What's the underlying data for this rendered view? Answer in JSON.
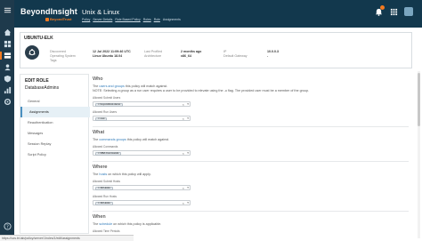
{
  "app": {
    "brand": "BeyondInsight",
    "brand_sub": "BeyondTrust",
    "page_heading": "Unix & Linux"
  },
  "breadcrumb": [
    "Policy",
    "Server Details",
    "Role Based Policy",
    "Roles",
    "Role",
    "Assignments"
  ],
  "asset": {
    "title": "UBUNTU-ELK",
    "fields": [
      {
        "k1": "Discovered",
        "k2": "Operating System",
        "k3": "Tags",
        "v1": "12 Jul 2022 11:09:46 UTC",
        "v2": "Linux Ubuntu 18.04"
      },
      {
        "k1": "Last Profiled",
        "k2": "Architecture",
        "v1": "2 months ago",
        "v2": "x86_64"
      },
      {
        "k1": "IP",
        "k2": "Default Gateway",
        "v1": "10.0.0.3",
        "v2": "-"
      }
    ]
  },
  "edit_role": {
    "title": "EDIT ROLE",
    "name": "DatabaseAdmins",
    "menu": [
      "General",
      "Assignments",
      "Reauthentication",
      "Messages",
      "Session Replay",
      "Script Policy"
    ],
    "active_index": 1
  },
  "who": {
    "title": "Who",
    "desc_pre": "The ",
    "desc_link": "users and groups",
    "desc_post": " this policy will match against.",
    "note": "NOTE: Selecting a group as a run user requires a user to be provided to elevate using the -u flag. The provided user must be a member of the group.",
    "submit_label": "Allowed Submit Users",
    "submit_chip": "beyondtrust-demo",
    "run_label": "Allowed Run Users",
    "run_chip": "root"
  },
  "what": {
    "title": "What",
    "desc_pre": "The ",
    "desc_link": "commands groups",
    "desc_post": " this policy will match against.",
    "cmd_label": "Allowed Commands",
    "cmd_chip": "DBA Commands"
  },
  "where": {
    "title": "Where",
    "desc_pre": "The ",
    "desc_link": "hosts",
    "desc_post": " on which this policy will apply.",
    "submit_hosts_label": "Allowed Submit Hosts",
    "submit_hosts_chip": "All Hosts",
    "run_hosts_label": "Allowed Run Hosts",
    "run_hosts_chip": "All Hosts"
  },
  "when": {
    "title": "When",
    "desc_pre": "The ",
    "desc_link": "schedule",
    "desc_post": " on which this policy is applicable.",
    "label": "Allowed Time Periods"
  },
  "status_url": "https://ucs.bt.lab/policy/server/1/roles/1/edit/assignments"
}
